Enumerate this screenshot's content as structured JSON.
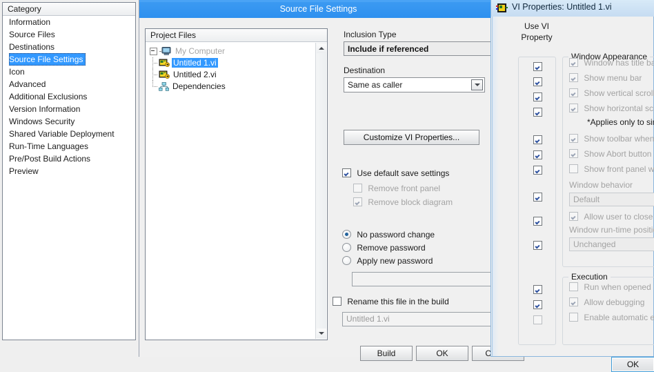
{
  "category_panel": {
    "header": "Category",
    "items": [
      {
        "label": "Information",
        "selected": false
      },
      {
        "label": "Source Files",
        "selected": false
      },
      {
        "label": "Destinations",
        "selected": false
      },
      {
        "label": "Source File Settings",
        "selected": true
      },
      {
        "label": "Icon",
        "selected": false
      },
      {
        "label": "Advanced",
        "selected": false
      },
      {
        "label": "Additional Exclusions",
        "selected": false
      },
      {
        "label": "Version Information",
        "selected": false
      },
      {
        "label": "Windows Security",
        "selected": false
      },
      {
        "label": "Shared Variable Deployment",
        "selected": false
      },
      {
        "label": "Run-Time Languages",
        "selected": false
      },
      {
        "label": "Pre/Post Build Actions",
        "selected": false
      },
      {
        "label": "Preview",
        "selected": false
      }
    ]
  },
  "main_dialog": {
    "title": "Source File Settings",
    "title_bar_color": "#2e90ef",
    "project_files": {
      "header": "Project Files",
      "tree": [
        {
          "label": "My Computer",
          "icon": "computer-icon",
          "dim": true,
          "selected": false,
          "level": 0
        },
        {
          "label": "Untitled 1.vi",
          "icon": "vi-icon",
          "dim": false,
          "selected": true,
          "level": 1
        },
        {
          "label": "Untitled 2.vi",
          "icon": "vi-icon",
          "dim": false,
          "selected": false,
          "level": 1
        },
        {
          "label": "Dependencies",
          "icon": "dependencies-icon",
          "dim": false,
          "selected": false,
          "level": 1
        }
      ],
      "selection_color": "#3399ff"
    },
    "inclusion_type": {
      "label": "Inclusion Type",
      "value": "Include if referenced"
    },
    "destination": {
      "label": "Destination",
      "value": "Same as caller"
    },
    "customize_button": "Customize VI Properties...",
    "save_settings": {
      "use_default_label": "Use default save settings",
      "use_default_checked": true,
      "remove_front_panel_label": "Remove front panel",
      "remove_front_panel_checked": false,
      "remove_block_diagram_label": "Remove block diagram",
      "remove_block_diagram_checked": true
    },
    "password": {
      "no_change_label": "No password change",
      "remove_label": "Remove password",
      "apply_new_label": "Apply new password",
      "selected": "no_change",
      "field_value": ""
    },
    "rename": {
      "checkbox_label": "Rename this file in the build",
      "checked": false,
      "field_value": "Untitled 1.vi"
    },
    "buttons": [
      {
        "label": "Build"
      },
      {
        "label": "OK"
      },
      {
        "label": "Cancel"
      }
    ]
  },
  "vi_properties": {
    "title": "VI Properties: Untitled 1.vi",
    "title_icon": "vi-properties-icon",
    "use_vi_property_header": "Use VI\nProperty",
    "use_vi_property_line1": "Use VI",
    "use_vi_property_line2": "Property",
    "window_appearance": {
      "title": "Window Appearance",
      "rows": [
        {
          "label": "Window has title bar",
          "checked": true,
          "use_vi": true
        },
        {
          "label": "Show menu bar",
          "checked": true,
          "use_vi": true
        },
        {
          "label": "Show vertical scroll bar",
          "checked": true,
          "use_vi": true
        },
        {
          "label": "Show horizontal scroll bar",
          "checked": true,
          "use_vi": true
        }
      ],
      "note": "*Applies only to single",
      "rows2": [
        {
          "label": "Show toolbar when running",
          "checked": true,
          "use_vi": true
        },
        {
          "label": "Show Abort button",
          "checked": true,
          "use_vi": true
        },
        {
          "label": "Show front panel when called",
          "checked": false,
          "use_vi": true
        }
      ],
      "window_behavior_label": "Window behavior",
      "window_behavior_value": "Default",
      "allow_close_label": "Allow user to close window",
      "allow_close_checked": true,
      "runtime_position_label": "Window run-time position",
      "runtime_position_value": "Unchanged"
    },
    "execution": {
      "title": "Execution",
      "rows": [
        {
          "label": "Run when opened",
          "checked": false,
          "use_vi": true
        },
        {
          "label": "Allow debugging",
          "checked": true,
          "use_vi": true
        },
        {
          "label": "Enable automatic error handling",
          "checked": false,
          "use_vi": false
        }
      ]
    },
    "ok_button": "OK",
    "accent_color": "#3c9ad6"
  }
}
